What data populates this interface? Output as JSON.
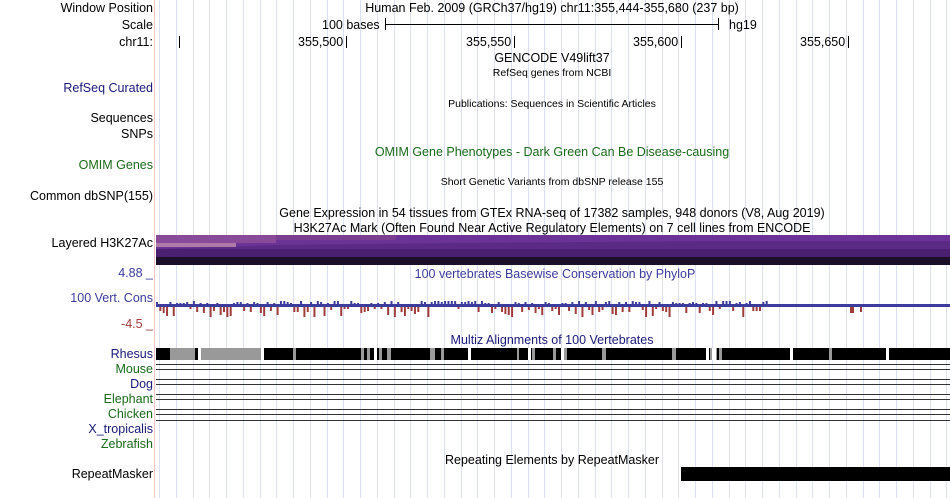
{
  "header": {
    "window_position_label": "Window Position",
    "window_position_value": "Human Feb. 2009 (GRCh37/hg19)   chr11:355,444-355,680 (237 bp)",
    "scale_label": "Scale",
    "scale_value": "100 bases",
    "scale_assembly": "hg19",
    "chrom_label": "chr11:",
    "ruler_ticks": [
      "355,500",
      "355,550",
      "355,600",
      "355,650"
    ]
  },
  "tracks": {
    "gencode": {
      "title": "GENCODE V49lift37"
    },
    "refseq": {
      "label": "RefSeq Curated",
      "title": "RefSeq genes from NCBI"
    },
    "publications": {
      "title": "Publications: Sequences in Scientific Articles"
    },
    "sequences": {
      "label": "Sequences"
    },
    "snps": {
      "label": "SNPs"
    },
    "omim": {
      "label": "OMIM Genes",
      "title": "OMIM Gene Phenotypes - Dark Green Can Be Disease-causing"
    },
    "dbsnp": {
      "label": "Common dbSNP(155)",
      "title": "Short Genetic Variants from dbSNP release 155"
    },
    "gtex": {
      "title": "Gene Expression in 54 tissues from GTEx RNA-seq of 17382 samples, 948 donors (V8, Aug 2019)"
    },
    "h3k27ac": {
      "label": "Layered H3K27Ac",
      "title": "H3K27Ac Mark (Often Found Near Active Regulatory Elements) on 7 cell lines from ENCODE"
    },
    "phylop": {
      "label": "100 Vert. Cons",
      "title": "100 vertebrates Basewise Conservation by PhyloP",
      "max": "4.88 _",
      "min": "-4.5 _"
    },
    "multiz": {
      "title": "Multiz Alignments of 100 Vertebrates",
      "species": [
        "Rhesus",
        "Mouse",
        "Dog",
        "Elephant",
        "Chicken",
        "X_tropicalis",
        "Zebrafish"
      ]
    },
    "repeatmasker": {
      "label": "RepeatMasker",
      "title": "Repeating Elements by RepeatMasker"
    }
  },
  "colors": {
    "label_blue": "#1a1a7a",
    "label_green": "#1a6a1a",
    "phylop_blue": "#3c3c9c",
    "phylop_red": "#a03c3c"
  }
}
